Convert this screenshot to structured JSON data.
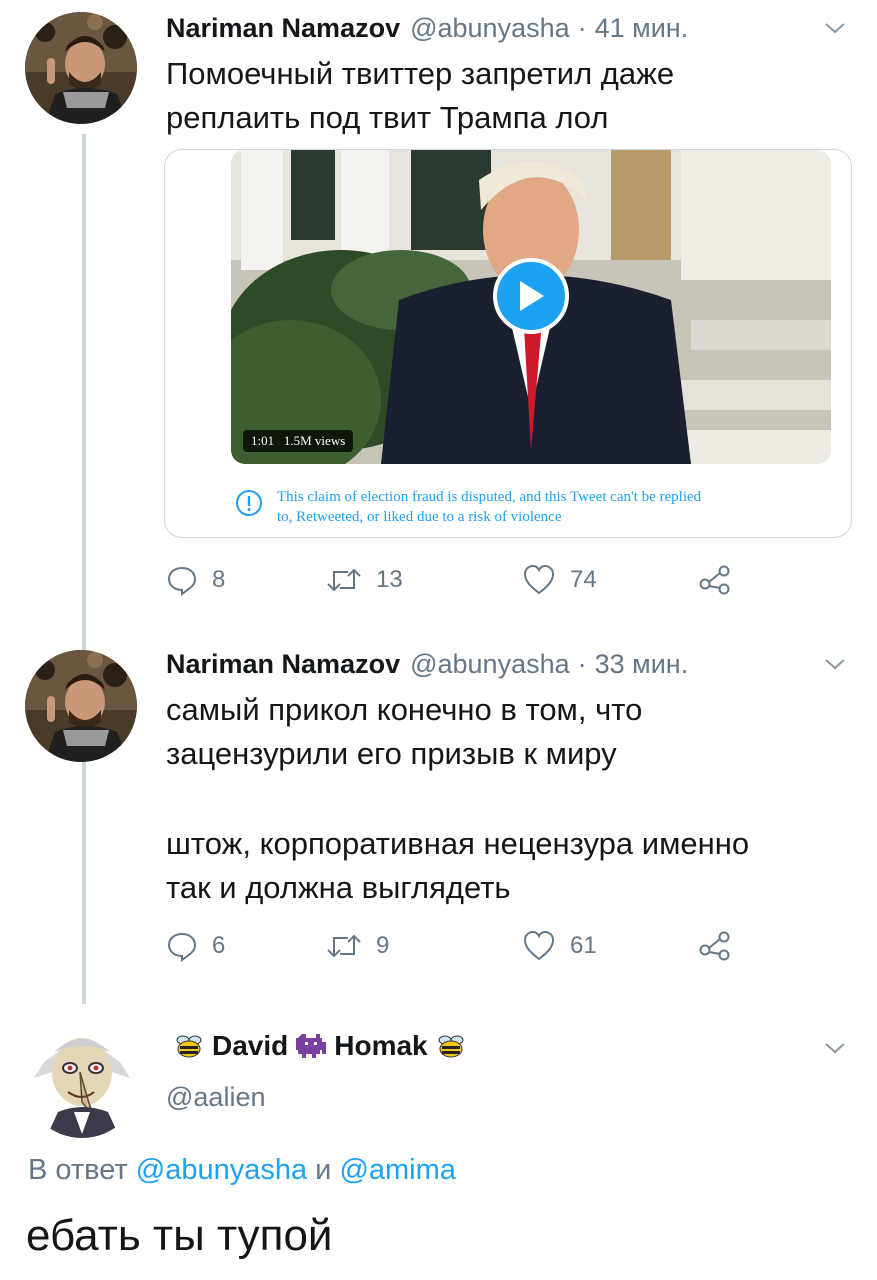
{
  "tweets": [
    {
      "author": {
        "name": "Nariman Namazov",
        "handle": "@abunyasha"
      },
      "time": "41 мин.",
      "separator": "·",
      "text_lines": [
        "Помоечный твиттер запретил даже",
        "реплаить под твит Трампа лол"
      ],
      "media": {
        "badge_duration": "1:01",
        "badge_views": "1.5M views",
        "notice_lines": [
          "This claim of election fraud is disputed, and this Tweet can't be replied",
          "to, Retweeted, or liked due to a risk of violence"
        ]
      },
      "actions": {
        "replies": "8",
        "retweets": "13",
        "likes": "74"
      }
    },
    {
      "author": {
        "name": "Nariman Namazov",
        "handle": "@abunyasha"
      },
      "time": "33 мин.",
      "separator": "·",
      "text_lines": [
        "самый прикол конечно в том, что",
        "зацензурили его призыв к миру",
        "",
        "штож, корпоративная нецензура именно",
        "так и должна выглядеть"
      ],
      "actions": {
        "replies": "6",
        "retweets": "9",
        "likes": "61"
      }
    }
  ],
  "reply": {
    "author": {
      "name_part1": "David",
      "name_part2": "Homak",
      "handle": "@aalien",
      "emoji_icons": [
        "bee-icon",
        "space-invader-icon",
        "bee-icon"
      ]
    },
    "reply_prefix": "В ответ",
    "mention1": "@abunyasha",
    "conjunction": "и",
    "mention2": "@amima",
    "text": "ебать ты тупой"
  },
  "colors": {
    "accent": "#1da1f2",
    "text": "#14171a",
    "secondary": "#657786",
    "thread_line": "#ccd6dd"
  }
}
